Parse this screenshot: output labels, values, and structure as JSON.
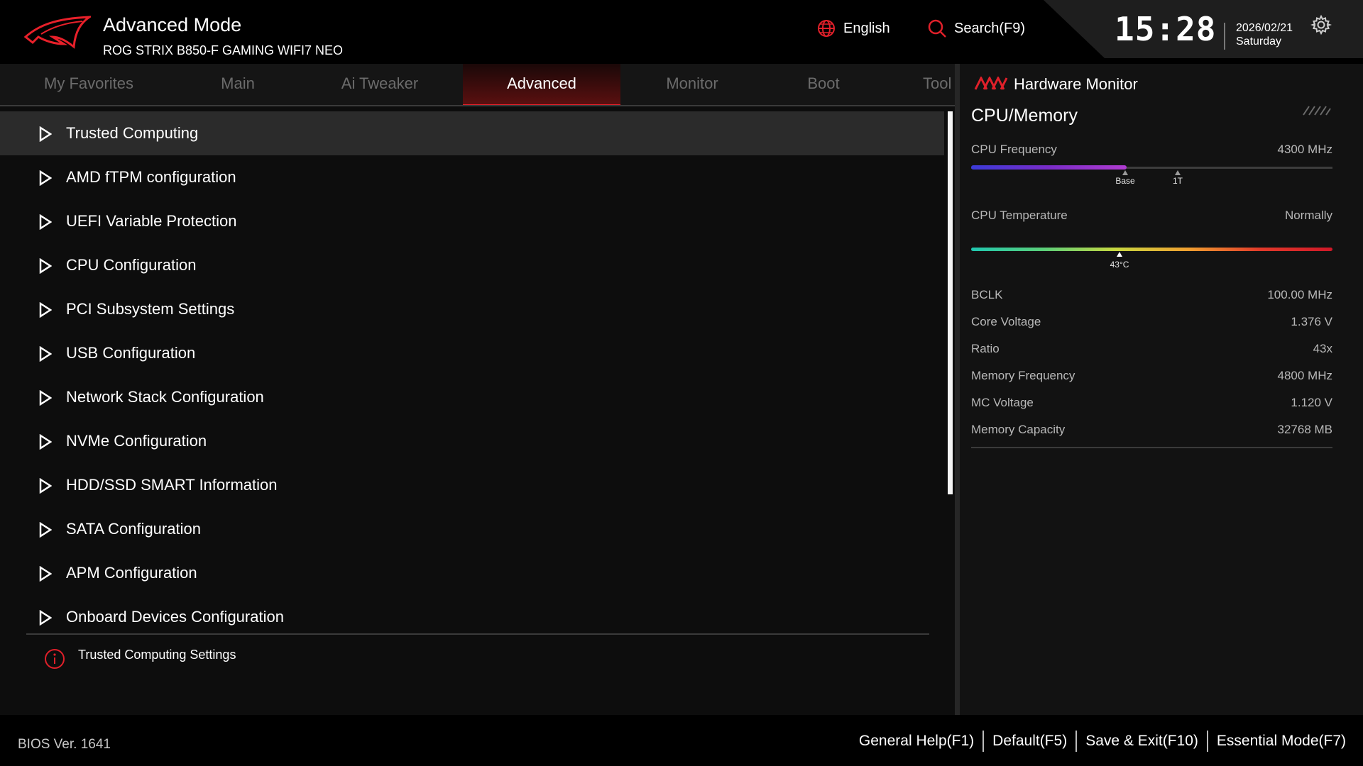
{
  "header": {
    "title": "Advanced Mode",
    "model": "ROG STRIX B850-F GAMING WIFI7 NEO",
    "language": "English",
    "search": "Search(F9)",
    "time": "15:28",
    "date": "2026/02/21",
    "day": "Saturday"
  },
  "tabs": [
    {
      "label": "My Favorites"
    },
    {
      "label": "Main"
    },
    {
      "label": "Ai Tweaker"
    },
    {
      "label": "Advanced",
      "active": true
    },
    {
      "label": "Monitor"
    },
    {
      "label": "Boot"
    },
    {
      "label": "Tool"
    }
  ],
  "menu": [
    {
      "label": "Trusted Computing"
    },
    {
      "label": "AMD fTPM configuration"
    },
    {
      "label": "UEFI Variable Protection"
    },
    {
      "label": "CPU Configuration"
    },
    {
      "label": "PCI Subsystem Settings"
    },
    {
      "label": "USB Configuration"
    },
    {
      "label": "Network Stack Configuration"
    },
    {
      "label": "NVMe Configuration"
    },
    {
      "label": "HDD/SSD SMART Information"
    },
    {
      "label": "SATA Configuration"
    },
    {
      "label": "APM Configuration"
    },
    {
      "label": "Onboard Devices Configuration"
    }
  ],
  "help": {
    "text": "Trusted Computing Settings"
  },
  "hardware_monitor": {
    "title": "Hardware Monitor",
    "section": "CPU/Memory",
    "cpu_frequency": {
      "label": "CPU Frequency",
      "value": "4300 MHz",
      "fill_fraction": 0.43,
      "base_label": "Base",
      "turbo_label": "1T"
    },
    "cpu_temperature": {
      "label": "CPU Temperature",
      "status": "Normally",
      "reading": "43°C",
      "position_fraction": 0.41
    },
    "stats": [
      {
        "label": "BCLK",
        "value": "100.00 MHz"
      },
      {
        "label": "Core Voltage",
        "value": "1.376 V"
      },
      {
        "label": "Ratio",
        "value": "43x"
      },
      {
        "label": "Memory Frequency",
        "value": "4800 MHz"
      },
      {
        "label": "MC Voltage",
        "value": "1.120 V"
      },
      {
        "label": "Memory Capacity",
        "value": "32768 MB"
      }
    ]
  },
  "footer": {
    "bios_version": "BIOS Ver. 1641",
    "actions": [
      {
        "label": "General Help(F1)"
      },
      {
        "label": "Default(F5)"
      },
      {
        "label": "Save & Exit(F10)"
      },
      {
        "label": "Essential Mode(F7)"
      }
    ]
  },
  "colors": {
    "accent": "#e0202a",
    "background": "#0d0d0d"
  }
}
